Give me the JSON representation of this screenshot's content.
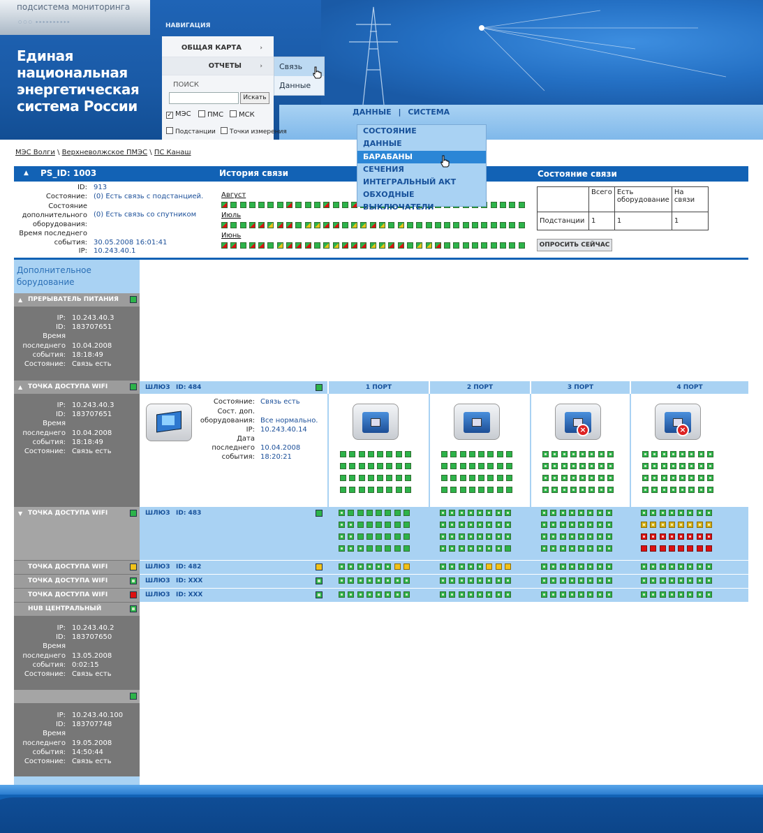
{
  "header": {
    "subsystem": "подсистема мониторинга",
    "brand": "Единая национальная энергетическая система России",
    "nav_label": "НАВИГАЦИЯ"
  },
  "nav": {
    "items": [
      {
        "label": "ОБЩАЯ КАРТА"
      },
      {
        "label": "ОТЧЕТЫ"
      }
    ],
    "submenu": [
      {
        "label": "Связь"
      },
      {
        "label": "Данные"
      }
    ]
  },
  "search": {
    "label": "ПОИСК",
    "button": "Искать",
    "value": ""
  },
  "filters": [
    {
      "label": "МЭС",
      "checked": true
    },
    {
      "label": "ПМС",
      "checked": false
    },
    {
      "label": "МСК",
      "checked": false
    },
    {
      "label": "Подстанции",
      "checked": false
    },
    {
      "label": "Точки измерения",
      "checked": false
    }
  ],
  "topnav": {
    "data": "ДАННЫЕ",
    "sep": "|",
    "system": "СИСТЕМА"
  },
  "dropdown": [
    {
      "label": "СОСТОЯНИЕ"
    },
    {
      "label": "ДАННЫЕ"
    },
    {
      "label": "БАРАБАНЫ"
    },
    {
      "label": "СЕЧЕНИЯ"
    },
    {
      "label": "ИНТЕГРАЛЬНЫЙ АКТ"
    },
    {
      "label": "ОБХОДНЫЕ ВЫКЛЮЧАТЕЛИ"
    }
  ],
  "breadcrumb": [
    "МЭС Волги",
    "Верхневолжское ПМЭС",
    "ПС Канаш"
  ],
  "station": {
    "title": "PS_ID: 1003",
    "history_title": "История связи",
    "state_title": "Состояние связи",
    "labels": {
      "id": "ID:",
      "state": "Состояние:",
      "extra_state": "Состояние дополнительного оборудования:",
      "last_event": "Время последнего события:",
      "ip": "IP:"
    },
    "values": {
      "id": "913",
      "state": "(0) Есть связь с подстанцией.",
      "extra_state": "(0) Есть связь со спутником",
      "last_event": "30.05.2008 16:01:41",
      "ip": "10.243.40.1"
    },
    "months": [
      "Август",
      "Июль",
      "Июнь"
    ],
    "history": {
      "Август": "rggggggrgggrggrgggggggggggggggggggggggggggggggggggggggggggg",
      "Июль": "rggrryrrgyyrrgyyrygyggggggggggggggggggggggggggggggggggggggg",
      "Июнь": "rrgrrgyrrrgyyrrryyrrgyyrggggggggggggggggggggggggggggggggggg"
    },
    "table": {
      "headers": [
        "",
        "Всего",
        "Есть оборудование",
        "На связи"
      ],
      "rows": [
        [
          "Подстанции",
          "1",
          "1",
          "1"
        ]
      ]
    },
    "poll_button": "ОПРОСИТЬ СЕЙЧАС"
  },
  "extra": {
    "title": "Дополнительное борудование",
    "devices": [
      {
        "name": "ПРЕРЫВАТЕЛЬ ПИТАНИЯ",
        "ip": "10.243.40.3",
        "id": "183707651",
        "date": "10.04.2008",
        "time": "18:18:49",
        "state": "Связь есть"
      },
      {
        "name": "ТОЧКА ДОСТУПА WIFI",
        "ip": "10.243.40.3",
        "id": "183707651",
        "date": "10.04.2008",
        "time": "18:18:49",
        "state": "Связь есть"
      },
      {
        "name": "ТОЧКА ДОСТУПА WIFI"
      },
      {
        "name": "ТОЧКА ДОСТУПА WIFI"
      },
      {
        "name": "ТОЧКА ДОСТУПА WIFI"
      },
      {
        "name": "ТОЧКА ДОСТУПА WIFI"
      },
      {
        "name": "HUB ЦЕНТРАЛЬНЫЙ",
        "ip": "10.243.40.2",
        "id": "183707650",
        "date": "13.05.2008",
        "time": "0:02:15",
        "state": "Связь есть"
      },
      {
        "name": "",
        "ip": "10.243.40.100",
        "id": "183707748",
        "date": "19.05.2008",
        "time": "14:50:44",
        "state": "Связь есть"
      }
    ],
    "kv_labels": {
      "ip": "IP:",
      "id": "ID:",
      "time1": "Время",
      "time2": "последнего",
      "time3": "события:",
      "state": "Состояние:"
    }
  },
  "gateway": {
    "label": "ШЛЮЗ",
    "ids": [
      "ID: 484",
      "ID: 483",
      "ID: 482",
      "ID: XXX",
      "ID: XXX"
    ],
    "ports": [
      "1 ПОРТ",
      "2 ПОРТ",
      "3 ПОРТ",
      "4 ПОРТ"
    ],
    "labels": {
      "state": "Состояние:",
      "extra1": "Сост. доп.",
      "extra2": "оборудования:",
      "ip": "IP:",
      "date1": "Дата",
      "date2": "последнего",
      "date3": "события:"
    },
    "values": {
      "state": "Связь есть",
      "extra": "Все нормально.",
      "ip": "10.243.40.14",
      "date": "10.04.2008",
      "time": "18:20:21"
    }
  }
}
